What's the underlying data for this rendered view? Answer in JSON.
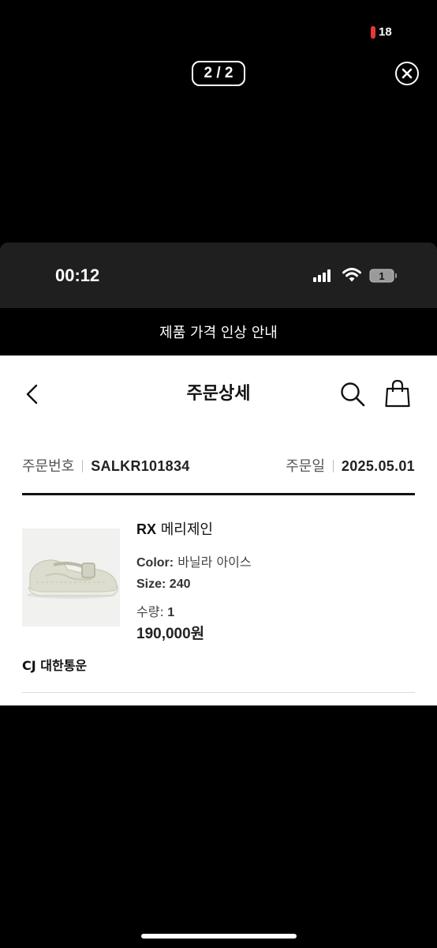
{
  "viewer": {
    "recording_count": "18",
    "pager_label": "2 / 2"
  },
  "status_bar": {
    "time": "00:12",
    "battery_level": "1"
  },
  "notice_banner": "제품 가격 인상 안내",
  "header": {
    "title": "주문상세"
  },
  "order": {
    "number_label": "주문번호",
    "number_value": "SALKR101834",
    "date_label": "주문일",
    "date_value": "2025.05.01"
  },
  "product": {
    "name_prefix": "RX",
    "name_rest": " 메리제인",
    "color_label": "Color:",
    "color_value": " 바닐라 아이스",
    "size_label": "Size:",
    "size_value": " 240",
    "qty_label": "수량:",
    "qty_value": " 1",
    "price": "190,000원"
  },
  "shipping": {
    "carrier": "CJ 대한통운"
  },
  "colors": {
    "background": "#000000",
    "page": "#ffffff",
    "recording": "#e8373a"
  }
}
